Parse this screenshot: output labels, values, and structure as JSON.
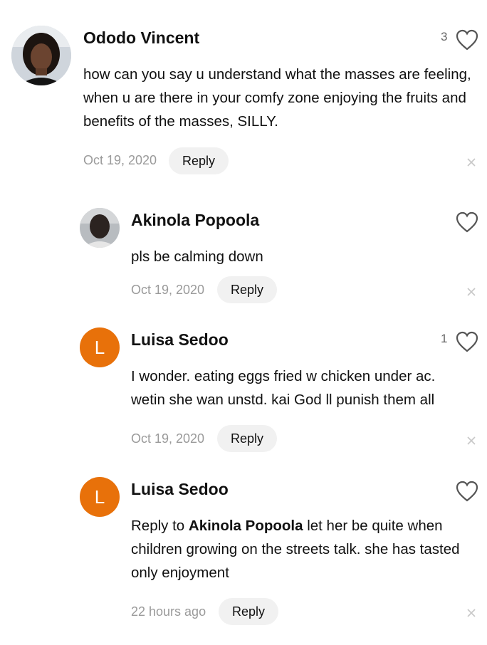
{
  "comments": [
    {
      "author": "Ododo Vincent",
      "text": "how can you say u understand what the masses are feeling,  when u are there in your comfy zone enjoying the fruits and benefits of the masses,  SILLY.",
      "date": "Oct 19, 2020",
      "reply_label": "Reply",
      "likes": "3"
    },
    {
      "author": "Akinola Popoola",
      "text": "pls be calming down",
      "date": "Oct 19, 2020",
      "reply_label": "Reply",
      "likes": ""
    },
    {
      "author": "Luisa Sedoo",
      "avatar_letter": "L",
      "text": "I wonder. eating eggs fried w chicken under ac. wetin she wan unstd. kai God ll punish them all",
      "date": "Oct 19, 2020",
      "reply_label": "Reply",
      "likes": "1"
    },
    {
      "author": "Luisa Sedoo",
      "avatar_letter": "L",
      "reply_prefix": "Reply to ",
      "reply_to": "Akinola Popoola",
      "text": " let her be quite when children growing on the streets talk. she has tasted only enjoyment",
      "date": "22 hours ago",
      "reply_label": "Reply",
      "likes": ""
    }
  ],
  "icons": {
    "like": "heart-outline-icon",
    "dismiss": "close-icon"
  },
  "colors": {
    "letter_avatar": "#e8710a",
    "muted": "#9a9a9a",
    "reply_bg": "#f1f1f1"
  }
}
